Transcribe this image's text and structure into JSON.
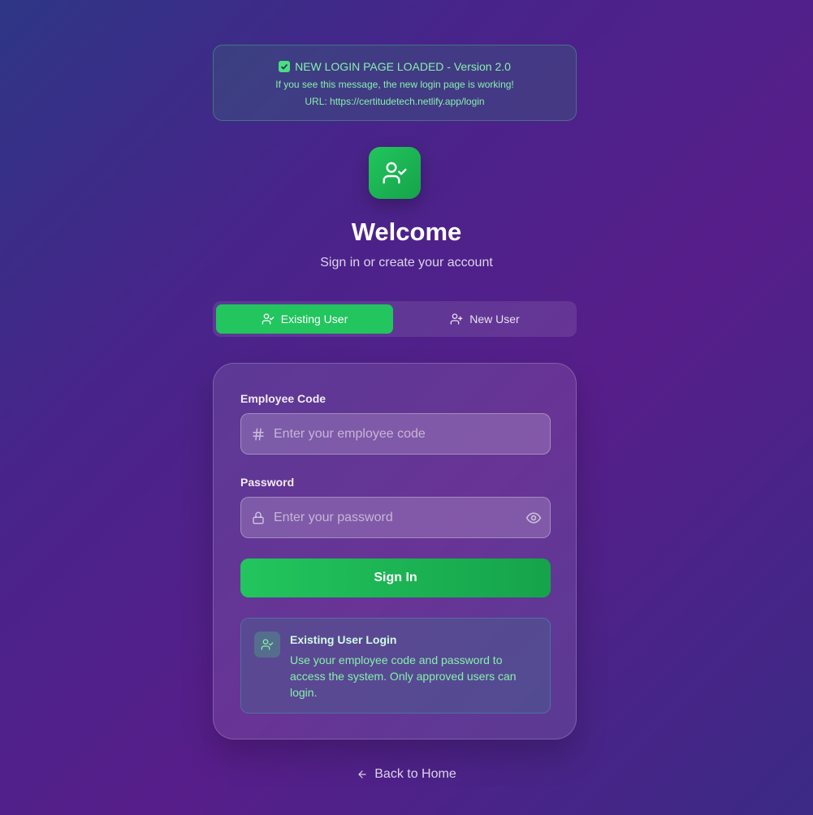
{
  "banner": {
    "title": "NEW LOGIN PAGE LOADED - Version 2.0",
    "message": "If you see this message, the new login page is working!",
    "url": "URL: https://certitudetech.netlify.app/login"
  },
  "header": {
    "title": "Welcome",
    "subtitle": "Sign in or create your account"
  },
  "tabs": [
    {
      "label": "Existing User",
      "active": true
    },
    {
      "label": "New User",
      "active": false
    }
  ],
  "form": {
    "employee_code": {
      "label": "Employee Code",
      "placeholder": "Enter your employee code",
      "value": ""
    },
    "password": {
      "label": "Password",
      "placeholder": "Enter your password",
      "value": ""
    },
    "submit_label": "Sign In"
  },
  "info": {
    "title": "Existing User Login",
    "text": "Use your employee code and password to access the system. Only approved users can login."
  },
  "footer": {
    "back_label": "Back to Home"
  },
  "colors": {
    "accent": "#22c55e",
    "banner_text": "#86efac"
  },
  "icons": [
    "check-icon",
    "user-check-icon",
    "user-plus-icon",
    "hash-icon",
    "lock-icon",
    "eye-icon",
    "arrow-left-icon"
  ]
}
